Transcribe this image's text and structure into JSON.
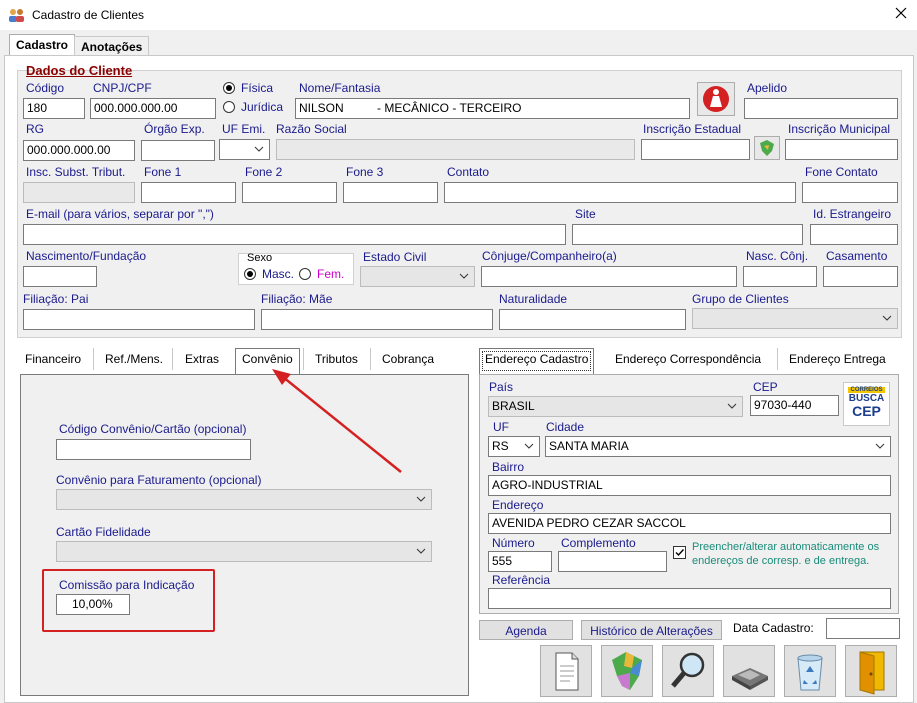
{
  "window": {
    "title": "Cadastro de Clientes"
  },
  "tabs": [
    "Cadastro",
    "Anotações"
  ],
  "section": {
    "title": "Dados do Cliente"
  },
  "fields": {
    "codigo": {
      "label": "Código",
      "value": "180"
    },
    "cnpj": {
      "label": "CNPJ/CPF",
      "value": "000.000.000.00"
    },
    "tipo": {
      "fisica": "Física",
      "juridica": "Jurídica"
    },
    "nome": {
      "label": "Nome/Fantasia",
      "value": "NILSON          - MECÂNICO - TERCEIRO"
    },
    "apelido": {
      "label": "Apelido",
      "value": ""
    },
    "rg": {
      "label": "RG",
      "value": "000.000.000.00"
    },
    "orgao": {
      "label": "Órgão Exp.",
      "value": ""
    },
    "uf_emi": {
      "label": "UF Emi.",
      "value": ""
    },
    "razao": {
      "label": "Razão Social",
      "value": ""
    },
    "insc_est": {
      "label": "Inscrição Estadual",
      "value": ""
    },
    "insc_mun": {
      "label": "Inscrição Municipal",
      "value": ""
    },
    "insc_subst": {
      "label": "Insc. Subst. Tribut."
    },
    "fone1": {
      "label": "Fone 1"
    },
    "fone2": {
      "label": "Fone 2"
    },
    "fone3": {
      "label": "Fone 3"
    },
    "contato": {
      "label": "Contato"
    },
    "fone_contato": {
      "label": "Fone Contato"
    },
    "email": {
      "label": "E-mail (para vários, separar por \",\")"
    },
    "site": {
      "label": "Site"
    },
    "id_estr": {
      "label": "Id. Estrangeiro"
    },
    "nasc": {
      "label": "Nascimento/Fundação"
    },
    "sexo": {
      "label": "Sexo",
      "masc": "Masc.",
      "fem": "Fem."
    },
    "estado_civil": {
      "label": "Estado Civil"
    },
    "conjuge": {
      "label": "Cônjuge/Companheiro(a)"
    },
    "nasc_conj": {
      "label": "Nasc. Cônj."
    },
    "casamento": {
      "label": "Casamento"
    },
    "filiacao_pai": {
      "label": "Filiação: Pai"
    },
    "filiacao_mae": {
      "label": "Filiação: Mãe"
    },
    "naturalidade": {
      "label": "Naturalidade"
    },
    "grupo": {
      "label": "Grupo de Clientes"
    }
  },
  "left_tabs": [
    "Financeiro",
    "Ref./Mens.",
    "Extras",
    "Convênio",
    "Tributos",
    "Cobrança"
  ],
  "convenio": {
    "codigo_label": "Código Convênio/Cartão (opcional)",
    "faturamento_label": "Convênio para Faturamento (opcional)",
    "cartao_label": "Cartão Fidelidade",
    "comissao_label": "Comissão para Indicação",
    "comissao_value": "10,00%"
  },
  "right_tabs": [
    "Endereço Cadastro",
    "Endereço Correspondência",
    "Endereço Entrega"
  ],
  "endereco": {
    "pais_label": "País",
    "pais": "BRASIL",
    "cep_label": "CEP",
    "cep": "97030-440",
    "busca_cep": {
      "top": "CORREIOS",
      "line1": "BUSCA",
      "line2": "CEP"
    },
    "uf_label": "UF",
    "uf": "RS",
    "cidade_label": "Cidade",
    "cidade": "SANTA MARIA",
    "bairro_label": "Bairro",
    "bairro": "AGRO-INDUSTRIAL",
    "endereco_label": "Endereço",
    "endereco": "AVENIDA PEDRO CEZAR SACCOL",
    "numero_label": "Número",
    "numero": "555",
    "complemento_label": "Complemento",
    "complemento": "",
    "preencher": "Preencher/alterar automaticamente os endereços de corresp. e de entrega.",
    "referencia_label": "Referência"
  },
  "bottom": {
    "agenda": "Agenda",
    "historico": "Histórico de Alterações",
    "data_label": "Data Cadastro:"
  },
  "colors": {
    "label": "#1a1a8c",
    "highlight": "#d42020",
    "section": "#8b0000"
  }
}
